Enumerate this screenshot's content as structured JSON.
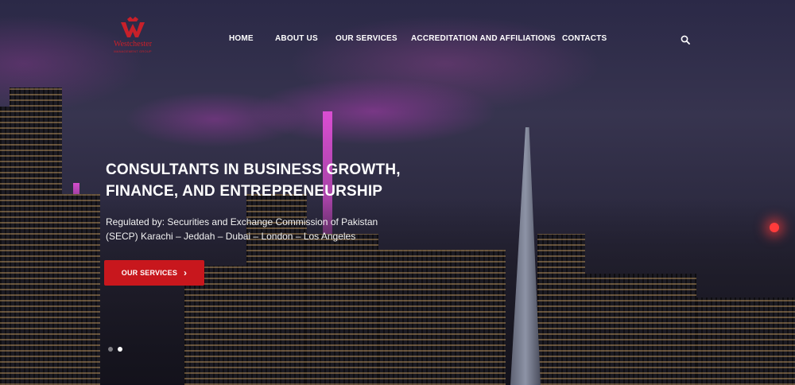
{
  "brand": {
    "name": "Westchester",
    "tagline": "MANAGEMENT GROUP",
    "color": "#c8202a"
  },
  "nav": {
    "items": [
      {
        "label": "HOME"
      },
      {
        "label": "ABOUT US"
      },
      {
        "label": "OUR SERVICES"
      },
      {
        "label": "ACCREDITATION AND AFFILIATIONS"
      },
      {
        "label": "CONTACTS"
      }
    ],
    "search_icon": "search-icon"
  },
  "hero": {
    "headline_line1": "CONSULTANTS IN BUSINESS GROWTH,",
    "headline_line2": "FINANCE, AND ENTREPRENEURSHIP",
    "sub_line1": "Regulated by: Securities and Exchange Commission of Pakistan",
    "sub_line2": "(SECP) Karachi – Jeddah – Dubai – London – Los Angeles",
    "cta_label": "OUR SERVICES",
    "cta_icon": "chevron-right-icon",
    "cta_color": "#c8171d",
    "slides_total": 2,
    "slide_active": 1
  }
}
